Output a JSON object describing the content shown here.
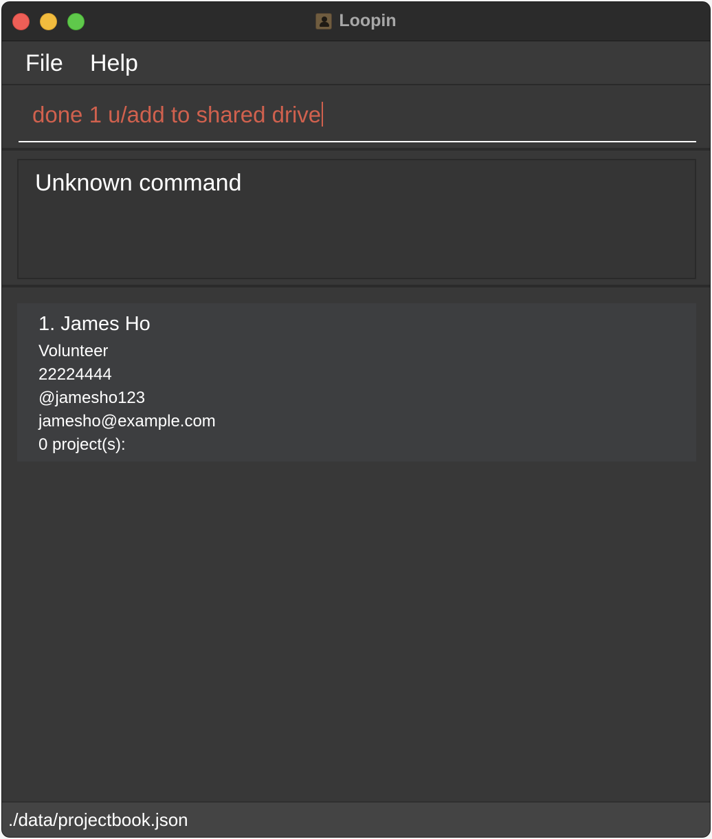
{
  "window": {
    "title": "Loopin",
    "icon": "contact-book-icon"
  },
  "menu": {
    "file": "File",
    "help": "Help"
  },
  "command": {
    "value": "done 1 u/add to shared drive",
    "color": "#d0614e"
  },
  "result": {
    "message": "Unknown command"
  },
  "persons": [
    {
      "name": "1. James Ho",
      "role": "Volunteer",
      "phone": "22224444",
      "telegram": "@jamesho123",
      "email": "jamesho@example.com",
      "projects": "0 project(s):"
    }
  ],
  "status": {
    "file_path": "./data/projectbook.json"
  }
}
